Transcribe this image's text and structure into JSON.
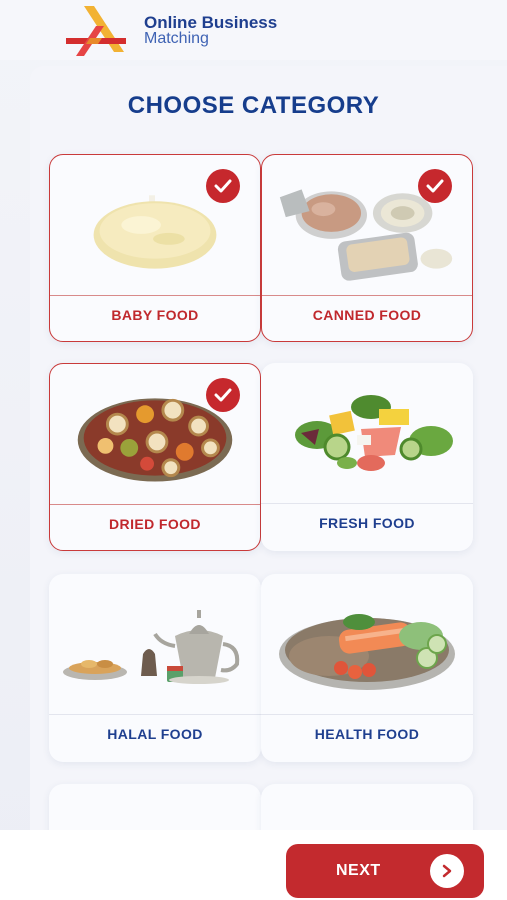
{
  "brand": {
    "line1": "Online Business",
    "line2": "Matching"
  },
  "page_title": "CHOOSE CATEGORY",
  "categories": [
    {
      "label": "BABY FOOD",
      "selected": true
    },
    {
      "label": "CANNED FOOD",
      "selected": true
    },
    {
      "label": "DRIED FOOD",
      "selected": true
    },
    {
      "label": "FRESH FOOD",
      "selected": false
    },
    {
      "label": "HALAL FOOD",
      "selected": false
    },
    {
      "label": "HEALTH FOOD",
      "selected": false
    }
  ],
  "next_button": {
    "label": "NEXT",
    "icon": "chevron-right-icon"
  },
  "colors": {
    "accent": "#c32a2e",
    "brand_blue": "#163d8c"
  }
}
